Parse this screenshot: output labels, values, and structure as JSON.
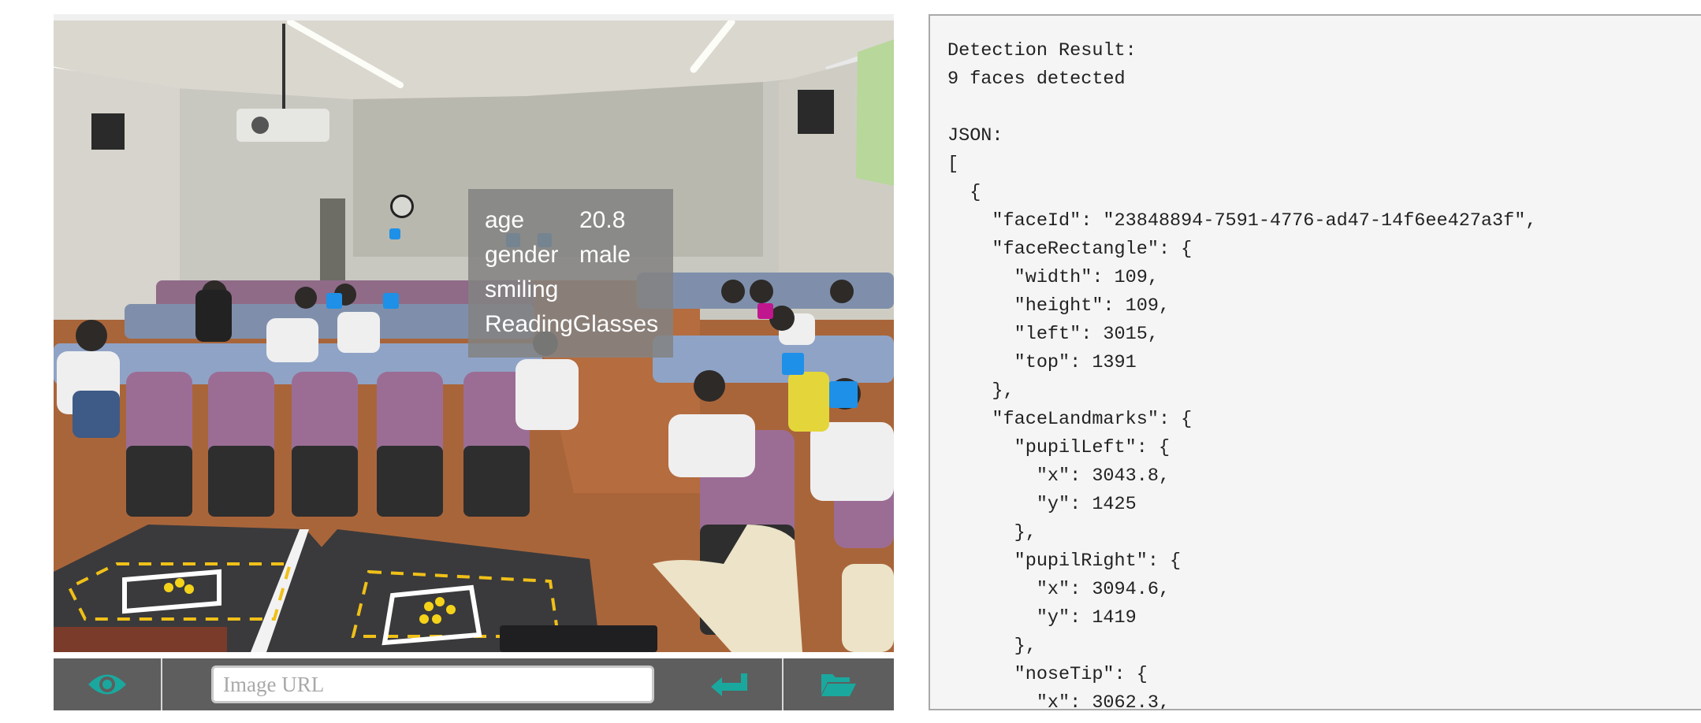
{
  "toolbar": {
    "url_placeholder": "Image URL",
    "eye_icon": "eye-icon",
    "enter_icon": "enter-arrow-icon",
    "folder_icon": "folder-open-icon",
    "icon_color": "#1aa89e"
  },
  "tooltip": {
    "rows": [
      {
        "key": "age",
        "value": "20.8"
      },
      {
        "key": "gender",
        "value": "male"
      },
      {
        "key": "smiling",
        "value": ""
      },
      {
        "key": "ReadingGlasses",
        "value": ""
      }
    ]
  },
  "face_box_colors": {
    "normal": "#1e90e8",
    "selected": "#c0168e"
  },
  "result": {
    "text": "Detection Result:\n9 faces detected\n\nJSON:\n[\n  {\n    \"faceId\": \"23848894-7591-4776-ad47-14f6ee427a3f\",\n    \"faceRectangle\": {\n      \"width\": 109,\n      \"height\": 109,\n      \"left\": 3015,\n      \"top\": 1391\n    },\n    \"faceLandmarks\": {\n      \"pupilLeft\": {\n        \"x\": 3043.8,\n        \"y\": 1425\n      },\n      \"pupilRight\": {\n        \"x\": 3094.6,\n        \"y\": 1419\n      },\n      \"noseTip\": {\n        \"x\": 3062.3,"
  }
}
